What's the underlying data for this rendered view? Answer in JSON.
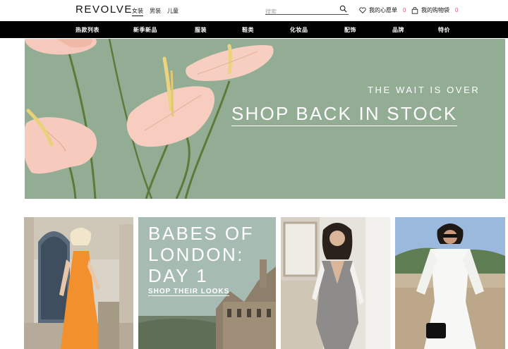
{
  "header": {
    "logo": "REVOLVE",
    "gender_tabs": [
      {
        "label": "女装",
        "active": true
      },
      {
        "label": "男装",
        "active": false
      },
      {
        "label": "儿童",
        "active": false
      }
    ],
    "search_placeholder": "搜索",
    "wishlist": {
      "label": "我的心愿单",
      "count": "0",
      "icon": "heart-icon"
    },
    "cart": {
      "label": "我的购物袋",
      "count": "0",
      "icon": "bag-icon"
    }
  },
  "nav": {
    "items": [
      "热款列表",
      "新季新品",
      "服装",
      "鞋类",
      "化妆品",
      "配饰",
      "品牌",
      "特价"
    ]
  },
  "hero": {
    "subtitle": "THE WAIT IS OVER",
    "cta": "SHOP BACK IN STOCK",
    "background_color": "#93ad95"
  },
  "tiles": {
    "tile2": {
      "heading": "BABES OF LONDON: DAY 1",
      "link": "SHOP THEIR LOOKS"
    }
  },
  "colors": {
    "count_accent": "#e05070",
    "nav_bg": "#000000"
  }
}
